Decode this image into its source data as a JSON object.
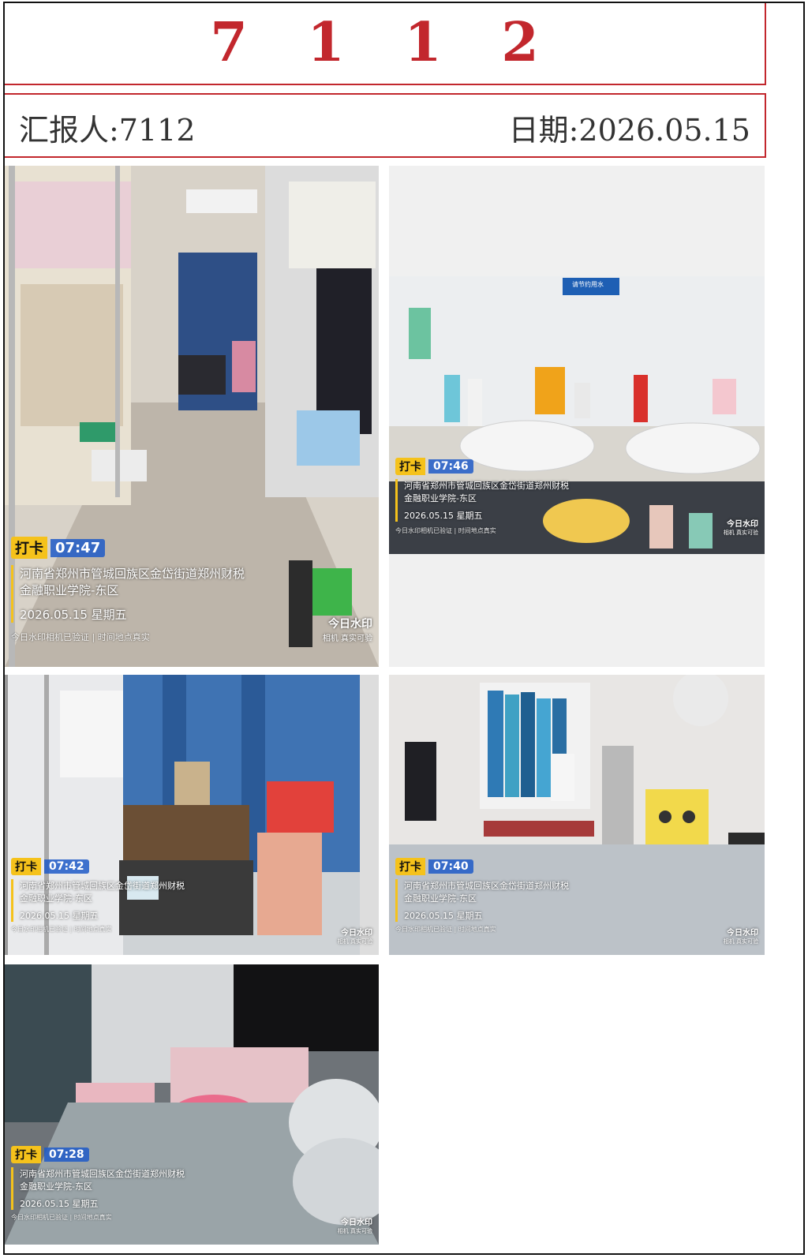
{
  "title": "7 1 1 2",
  "reporter_label": "汇报人:7112",
  "date_label": "日期:2026.05.15",
  "photos": [
    {
      "tag": "打卡",
      "time": "07:47",
      "address": "河南省郑州市管城回族区金岱街道郑州财税",
      "address2": "金融职业学院-东区",
      "date": "2026.05.15 星期五",
      "verify": "今日水印相机已验证 | 时间地点真实",
      "brand": "今日水印",
      "brand_sub": "相机 真实可验"
    },
    {
      "tag": "打卡",
      "time": "07:46",
      "address": "河南省郑州市管城回族区金岱街道郑州财税",
      "address2": "金融职业学院-东区",
      "date": "2026.05.15 星期五",
      "verify": "今日水印相机已验证 | 时间地点真实",
      "brand": "今日水印",
      "brand_sub": "相机 真实可验",
      "sign": "请节约用水"
    },
    {
      "tag": "打卡",
      "time": "07:42",
      "address": "河南省郑州市管城回族区金岱街道郑州财税",
      "address2": "金融职业学院-东区",
      "date": "2026.05.15 星期五",
      "verify": "今日水印相机已验证 | 时间地点真实",
      "brand": "今日水印",
      "brand_sub": "相机 真实可验"
    },
    {
      "tag": "打卡",
      "time": "07:40",
      "address": "河南省郑州市管城回族区金岱街道郑州财税",
      "address2": "金融职业学院-东区",
      "date": "2026.05.15 星期五",
      "verify": "今日水印相机已验证 | 时间地点真实",
      "brand": "今日水印",
      "brand_sub": "相机 真实可验"
    },
    {
      "tag": "打卡",
      "time": "07:28",
      "address": "河南省郑州市管城回族区金岱街道郑州财税",
      "address2": "金融职业学院-东区",
      "date": "2026.05.15 星期五",
      "verify": "今日水印相机已验证 | 时间地点真实",
      "brand": "今日水印",
      "brand_sub": "相机 真实可验"
    }
  ]
}
